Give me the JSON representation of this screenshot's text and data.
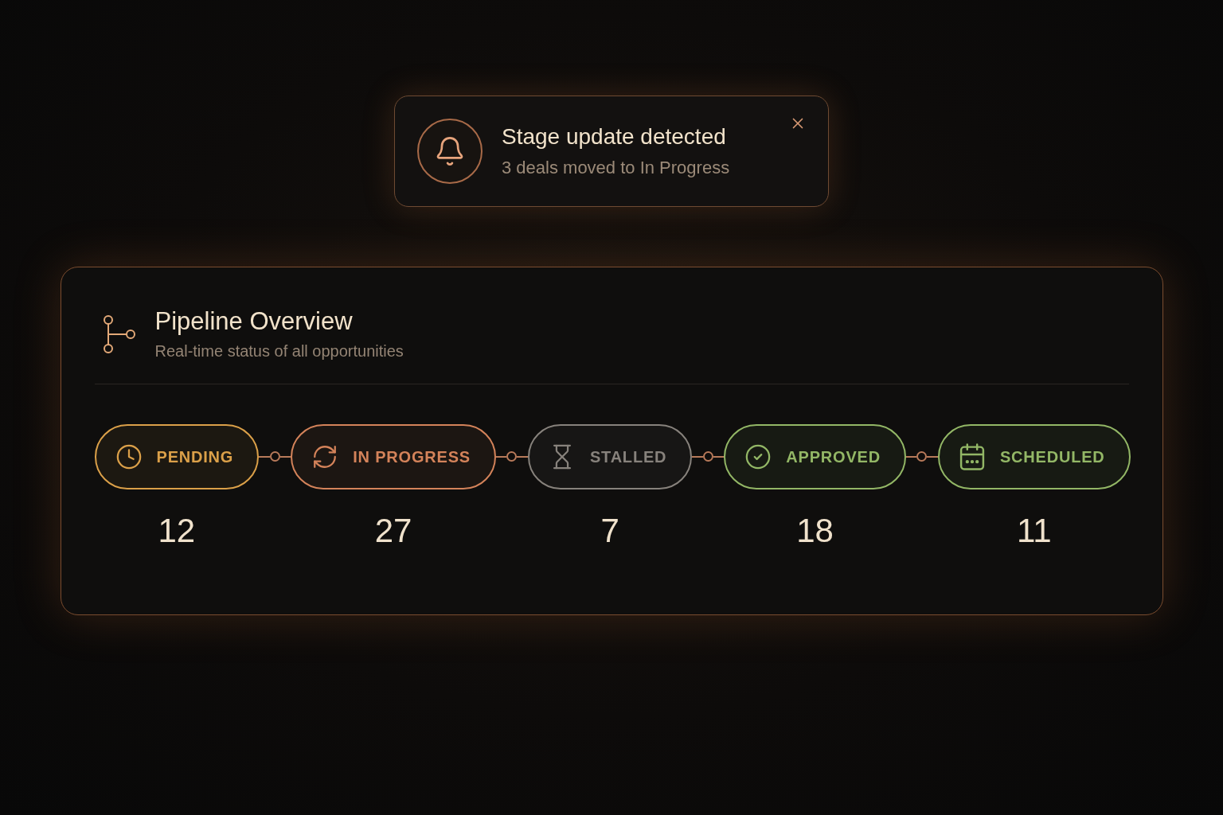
{
  "toast": {
    "title": "Stage update detected",
    "message": "3 deals moved to In Progress"
  },
  "card": {
    "title": "Pipeline Overview",
    "subtitle": "Real-time status of all opportunities"
  },
  "stages": [
    {
      "kind": "pending",
      "label": "PENDING",
      "count": "12",
      "color": "#dba049"
    },
    {
      "kind": "in_progress",
      "label": "IN PROGRESS",
      "count": "27",
      "color": "#d4835a"
    },
    {
      "kind": "stalled",
      "label": "STALLED",
      "count": "7",
      "color": "#87827c"
    },
    {
      "kind": "approved",
      "label": "APPROVED",
      "count": "18",
      "color": "#93b766"
    },
    {
      "kind": "scheduled",
      "label": "SCHEDULED",
      "count": "11",
      "color": "#93b766"
    }
  ]
}
